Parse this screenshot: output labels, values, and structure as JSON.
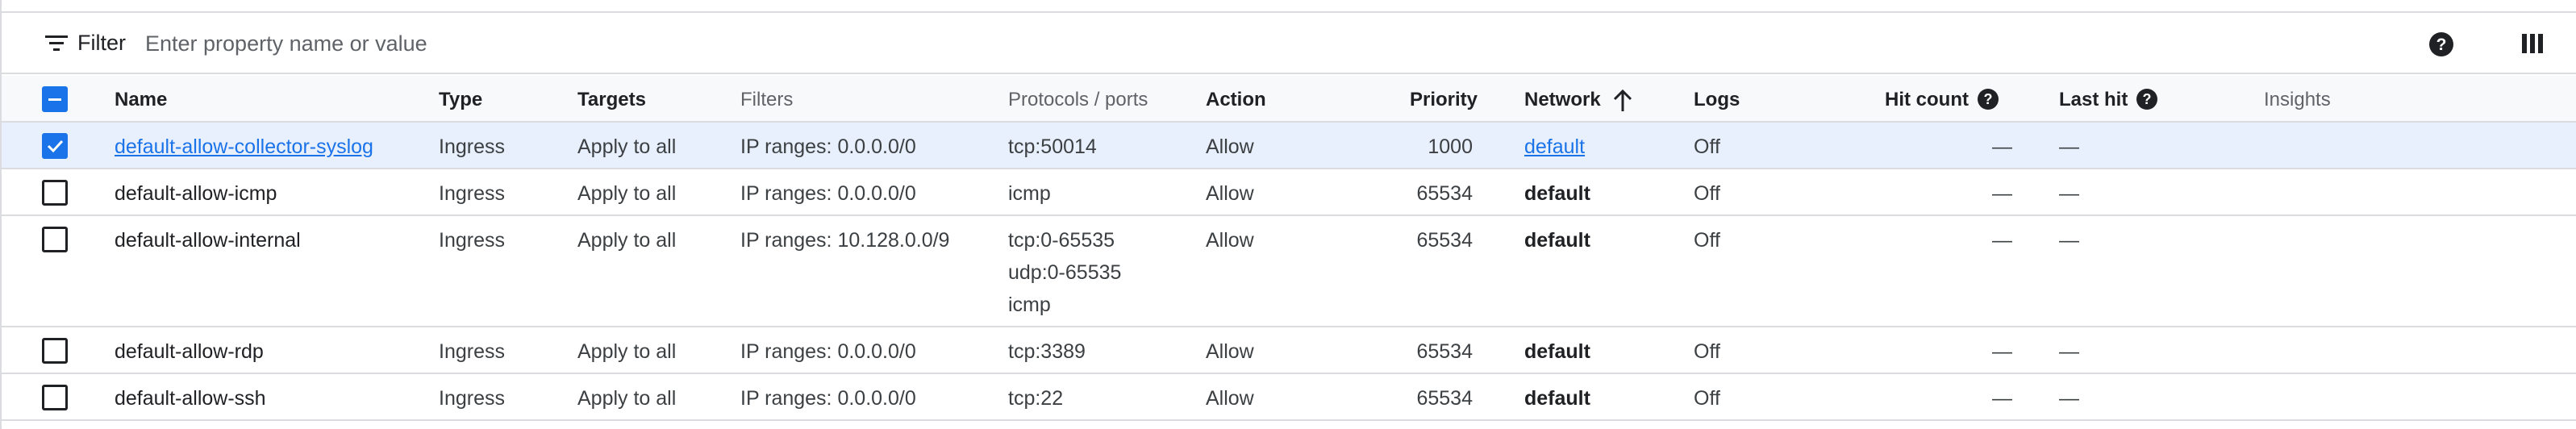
{
  "filter": {
    "label": "Filter",
    "placeholder": "Enter property name or value"
  },
  "columns": {
    "name": "Name",
    "type": "Type",
    "targets": "Targets",
    "filters": "Filters",
    "protocols": "Protocols / ports",
    "action": "Action",
    "priority": "Priority",
    "network": "Network",
    "logs": "Logs",
    "hit_count": "Hit count",
    "last_hit": "Last hit",
    "insights": "Insights"
  },
  "rows": [
    {
      "checked": true,
      "name": "default-allow-collector-syslog",
      "type": "Ingress",
      "targets": "Apply to all",
      "filters": "IP ranges: 0.0.0.0/0",
      "protocols": [
        "tcp:50014"
      ],
      "action": "Allow",
      "priority": "1000",
      "network": "default",
      "logs": "Off",
      "hit_count": "—",
      "last_hit": "—"
    },
    {
      "checked": false,
      "name": "default-allow-icmp",
      "type": "Ingress",
      "targets": "Apply to all",
      "filters": "IP ranges: 0.0.0.0/0",
      "protocols": [
        "icmp"
      ],
      "action": "Allow",
      "priority": "65534",
      "network": "default",
      "logs": "Off",
      "hit_count": "—",
      "last_hit": "—"
    },
    {
      "checked": false,
      "name": "default-allow-internal",
      "type": "Ingress",
      "targets": "Apply to all",
      "filters": "IP ranges: 10.128.0.0/9",
      "protocols": [
        "tcp:0-65535",
        "udp:0-65535",
        "icmp"
      ],
      "action": "Allow",
      "priority": "65534",
      "network": "default",
      "logs": "Off",
      "hit_count": "—",
      "last_hit": "—"
    },
    {
      "checked": false,
      "name": "default-allow-rdp",
      "type": "Ingress",
      "targets": "Apply to all",
      "filters": "IP ranges: 0.0.0.0/0",
      "protocols": [
        "tcp:3389"
      ],
      "action": "Allow",
      "priority": "65534",
      "network": "default",
      "logs": "Off",
      "hit_count": "—",
      "last_hit": "—"
    },
    {
      "checked": false,
      "name": "default-allow-ssh",
      "type": "Ingress",
      "targets": "Apply to all",
      "filters": "IP ranges: 0.0.0.0/0",
      "protocols": [
        "tcp:22"
      ],
      "action": "Allow",
      "priority": "65534",
      "network": "default",
      "logs": "Off",
      "hit_count": "—",
      "last_hit": "—"
    }
  ],
  "icons": {
    "filter": "filter-list-icon",
    "help": "help-circle-icon",
    "columns": "column-display-icon",
    "sort": "arrow-upward-icon",
    "header_checkbox": "indeterminate-checkbox-icon"
  },
  "colors": {
    "accent": "#1a73e8",
    "selected_row": "#e8f0fe",
    "header_bg": "#f8f9fa",
    "border": "#dadce0"
  }
}
